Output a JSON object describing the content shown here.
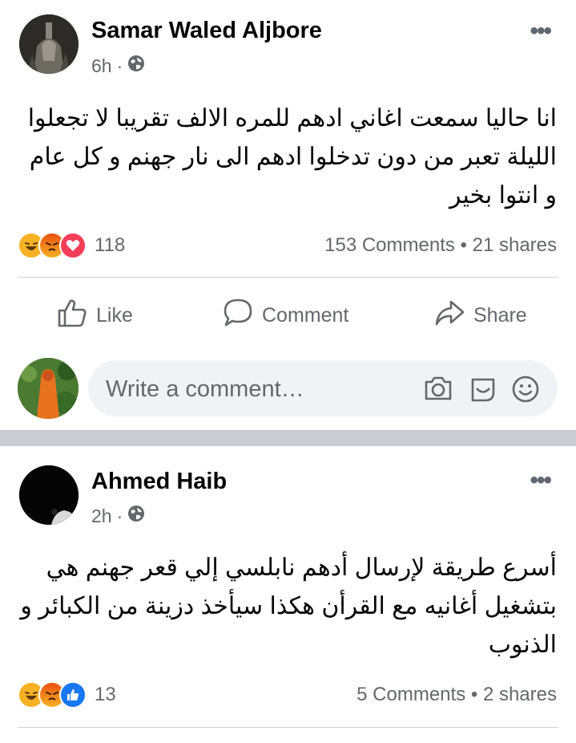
{
  "posts": [
    {
      "author": "Samar Waled Aljbore",
      "time": "6h",
      "dot": "·",
      "privacy_icon": "globe-icon",
      "more_icon": "more-icon",
      "more": "•••",
      "text": "انا حاليا سمعت اغاني ادهم للمره الالف تقريبا لا تجعلوا الليلة تعبر من دون تدخلوا ادهم الى نار جهنم و كل عام و انتوا بخير",
      "reactions": [
        "haha",
        "angry",
        "love"
      ],
      "reaction_count": "118",
      "stats": "153 Comments • 21 shares"
    },
    {
      "author": "Ahmed Haib",
      "time": "2h",
      "dot": "·",
      "privacy_icon": "globe-icon",
      "more_icon": "more-icon",
      "more": "•••",
      "text": "أسرع طريقة لإرسال أدهم نابلسي إلي قعر جهنم هي بتشغيل أغانيه مع القرأن هكذا سيأخذ دزينة من الكبائر و الذنوب",
      "reactions": [
        "haha",
        "angry",
        "like"
      ],
      "reaction_count": "13",
      "stats": "5 Comments • 2 shares"
    }
  ],
  "actions": {
    "like": "Like",
    "comment": "Comment",
    "share": "Share"
  },
  "comment_box": {
    "placeholder": "Write a comment…",
    "icons": [
      "camera-icon",
      "gif-sticker-icon",
      "emoji-icon"
    ]
  },
  "colors": {
    "text": "#050505",
    "secondary": "#65676b",
    "divider": "#ced0d4",
    "separator": "#c9ccd1",
    "comment_bg": "#f0f2f5",
    "haha": "#f7b125",
    "angry": "#e9710f",
    "love": "#f33e58",
    "like": "#1877f2"
  }
}
